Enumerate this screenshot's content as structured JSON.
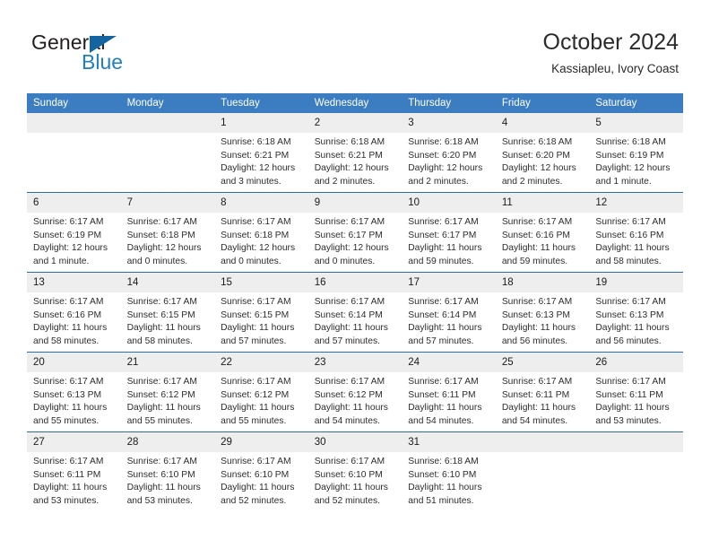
{
  "brand": {
    "word1": "General",
    "word2": "Blue",
    "triangle_color": "#1464a0",
    "blue_color": "#1f7fc4"
  },
  "header": {
    "title": "October 2024",
    "subtitle": "Kassiapleu, Ivory Coast"
  },
  "theme": {
    "header_row_bg": "#3b7dc0",
    "row_divider": "#2a6db3",
    "daynum_bg": "#eeeeee",
    "text": "#2d2d2d"
  },
  "weekdays": [
    "Sunday",
    "Monday",
    "Tuesday",
    "Wednesday",
    "Thursday",
    "Friday",
    "Saturday"
  ],
  "labels": {
    "sunrise_prefix": "Sunrise:",
    "sunset_prefix": "Sunset:",
    "daylight_prefix": "Daylight:"
  },
  "weeks": [
    [
      {
        "day": "",
        "blank": true,
        "line1": "",
        "line2": "",
        "line3": "",
        "line4": ""
      },
      {
        "day": "",
        "blank": true,
        "line1": "",
        "line2": "",
        "line3": "",
        "line4": ""
      },
      {
        "day": "1",
        "line1": "Sunrise: 6:18 AM",
        "line2": "Sunset: 6:21 PM",
        "line3": "Daylight: 12 hours",
        "line4": "and 3 minutes."
      },
      {
        "day": "2",
        "line1": "Sunrise: 6:18 AM",
        "line2": "Sunset: 6:21 PM",
        "line3": "Daylight: 12 hours",
        "line4": "and 2 minutes."
      },
      {
        "day": "3",
        "line1": "Sunrise: 6:18 AM",
        "line2": "Sunset: 6:20 PM",
        "line3": "Daylight: 12 hours",
        "line4": "and 2 minutes."
      },
      {
        "day": "4",
        "line1": "Sunrise: 6:18 AM",
        "line2": "Sunset: 6:20 PM",
        "line3": "Daylight: 12 hours",
        "line4": "and 2 minutes."
      },
      {
        "day": "5",
        "line1": "Sunrise: 6:18 AM",
        "line2": "Sunset: 6:19 PM",
        "line3": "Daylight: 12 hours",
        "line4": "and 1 minute."
      }
    ],
    [
      {
        "day": "6",
        "line1": "Sunrise: 6:17 AM",
        "line2": "Sunset: 6:19 PM",
        "line3": "Daylight: 12 hours",
        "line4": "and 1 minute."
      },
      {
        "day": "7",
        "line1": "Sunrise: 6:17 AM",
        "line2": "Sunset: 6:18 PM",
        "line3": "Daylight: 12 hours",
        "line4": "and 0 minutes."
      },
      {
        "day": "8",
        "line1": "Sunrise: 6:17 AM",
        "line2": "Sunset: 6:18 PM",
        "line3": "Daylight: 12 hours",
        "line4": "and 0 minutes."
      },
      {
        "day": "9",
        "line1": "Sunrise: 6:17 AM",
        "line2": "Sunset: 6:17 PM",
        "line3": "Daylight: 12 hours",
        "line4": "and 0 minutes."
      },
      {
        "day": "10",
        "line1": "Sunrise: 6:17 AM",
        "line2": "Sunset: 6:17 PM",
        "line3": "Daylight: 11 hours",
        "line4": "and 59 minutes."
      },
      {
        "day": "11",
        "line1": "Sunrise: 6:17 AM",
        "line2": "Sunset: 6:16 PM",
        "line3": "Daylight: 11 hours",
        "line4": "and 59 minutes."
      },
      {
        "day": "12",
        "line1": "Sunrise: 6:17 AM",
        "line2": "Sunset: 6:16 PM",
        "line3": "Daylight: 11 hours",
        "line4": "and 58 minutes."
      }
    ],
    [
      {
        "day": "13",
        "line1": "Sunrise: 6:17 AM",
        "line2": "Sunset: 6:16 PM",
        "line3": "Daylight: 11 hours",
        "line4": "and 58 minutes."
      },
      {
        "day": "14",
        "line1": "Sunrise: 6:17 AM",
        "line2": "Sunset: 6:15 PM",
        "line3": "Daylight: 11 hours",
        "line4": "and 58 minutes."
      },
      {
        "day": "15",
        "line1": "Sunrise: 6:17 AM",
        "line2": "Sunset: 6:15 PM",
        "line3": "Daylight: 11 hours",
        "line4": "and 57 minutes."
      },
      {
        "day": "16",
        "line1": "Sunrise: 6:17 AM",
        "line2": "Sunset: 6:14 PM",
        "line3": "Daylight: 11 hours",
        "line4": "and 57 minutes."
      },
      {
        "day": "17",
        "line1": "Sunrise: 6:17 AM",
        "line2": "Sunset: 6:14 PM",
        "line3": "Daylight: 11 hours",
        "line4": "and 57 minutes."
      },
      {
        "day": "18",
        "line1": "Sunrise: 6:17 AM",
        "line2": "Sunset: 6:13 PM",
        "line3": "Daylight: 11 hours",
        "line4": "and 56 minutes."
      },
      {
        "day": "19",
        "line1": "Sunrise: 6:17 AM",
        "line2": "Sunset: 6:13 PM",
        "line3": "Daylight: 11 hours",
        "line4": "and 56 minutes."
      }
    ],
    [
      {
        "day": "20",
        "line1": "Sunrise: 6:17 AM",
        "line2": "Sunset: 6:13 PM",
        "line3": "Daylight: 11 hours",
        "line4": "and 55 minutes."
      },
      {
        "day": "21",
        "line1": "Sunrise: 6:17 AM",
        "line2": "Sunset: 6:12 PM",
        "line3": "Daylight: 11 hours",
        "line4": "and 55 minutes."
      },
      {
        "day": "22",
        "line1": "Sunrise: 6:17 AM",
        "line2": "Sunset: 6:12 PM",
        "line3": "Daylight: 11 hours",
        "line4": "and 55 minutes."
      },
      {
        "day": "23",
        "line1": "Sunrise: 6:17 AM",
        "line2": "Sunset: 6:12 PM",
        "line3": "Daylight: 11 hours",
        "line4": "and 54 minutes."
      },
      {
        "day": "24",
        "line1": "Sunrise: 6:17 AM",
        "line2": "Sunset: 6:11 PM",
        "line3": "Daylight: 11 hours",
        "line4": "and 54 minutes."
      },
      {
        "day": "25",
        "line1": "Sunrise: 6:17 AM",
        "line2": "Sunset: 6:11 PM",
        "line3": "Daylight: 11 hours",
        "line4": "and 54 minutes."
      },
      {
        "day": "26",
        "line1": "Sunrise: 6:17 AM",
        "line2": "Sunset: 6:11 PM",
        "line3": "Daylight: 11 hours",
        "line4": "and 53 minutes."
      }
    ],
    [
      {
        "day": "27",
        "line1": "Sunrise: 6:17 AM",
        "line2": "Sunset: 6:11 PM",
        "line3": "Daylight: 11 hours",
        "line4": "and 53 minutes."
      },
      {
        "day": "28",
        "line1": "Sunrise: 6:17 AM",
        "line2": "Sunset: 6:10 PM",
        "line3": "Daylight: 11 hours",
        "line4": "and 53 minutes."
      },
      {
        "day": "29",
        "line1": "Sunrise: 6:17 AM",
        "line2": "Sunset: 6:10 PM",
        "line3": "Daylight: 11 hours",
        "line4": "and 52 minutes."
      },
      {
        "day": "30",
        "line1": "Sunrise: 6:17 AM",
        "line2": "Sunset: 6:10 PM",
        "line3": "Daylight: 11 hours",
        "line4": "and 52 minutes."
      },
      {
        "day": "31",
        "line1": "Sunrise: 6:18 AM",
        "line2": "Sunset: 6:10 PM",
        "line3": "Daylight: 11 hours",
        "line4": "and 51 minutes."
      },
      {
        "day": "",
        "blank": true,
        "line1": "",
        "line2": "",
        "line3": "",
        "line4": ""
      },
      {
        "day": "",
        "blank": true,
        "line1": "",
        "line2": "",
        "line3": "",
        "line4": ""
      }
    ]
  ]
}
